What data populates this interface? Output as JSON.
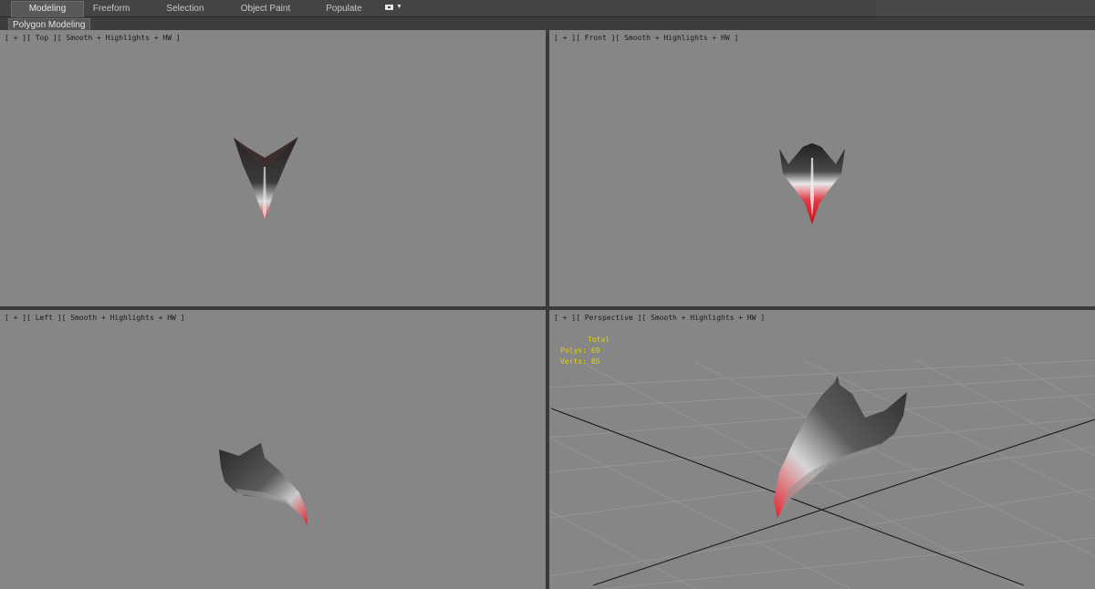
{
  "ribbon": {
    "tabs": [
      {
        "label": "Modeling",
        "active": true
      },
      {
        "label": "Freeform",
        "active": false
      },
      {
        "label": "Selection",
        "active": false
      },
      {
        "label": "Object Paint",
        "active": false
      },
      {
        "label": "Populate",
        "active": false
      }
    ],
    "extra_icon": "ribbon-options-icon",
    "panel_label": "Polygon Modeling"
  },
  "viewports": {
    "top": {
      "label": "[ + ][ Top ][ Smooth + Highlights + HW ]"
    },
    "front": {
      "label": "[ + ][ Front ][ Smooth + Highlights + HW ]"
    },
    "left": {
      "label": "[ + ][ Left ][ Smooth + Highlights + HW ]"
    },
    "perspective": {
      "label": "[ + ][ Perspective ][ Smooth + Highlights + HW ]"
    }
  },
  "statistics": {
    "header": "Total",
    "polys": "Polys: 69",
    "verts": "Verts: 85"
  },
  "colors": {
    "viewport_bg": "#868686",
    "border": "#3a3a3a",
    "stats_text": "#e4d200",
    "model_dark": "#2a2a2a",
    "model_red": "#e0202c"
  }
}
